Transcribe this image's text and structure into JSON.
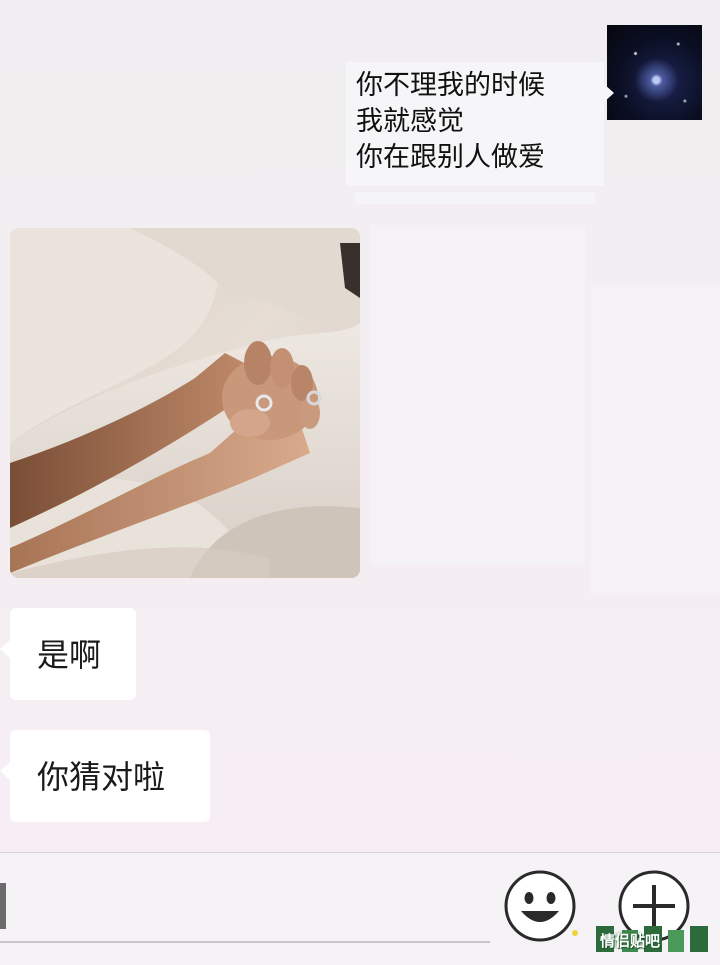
{
  "conversation": {
    "outgoing_message": {
      "lines": [
        "你不理我的时候",
        "我就感觉",
        "你在跟别人做爱"
      ],
      "avatar_icon": "starry-galaxy-avatar"
    },
    "photo_message": {
      "icon": "photo-holding-hands"
    },
    "incoming_messages": [
      {
        "text": "是啊"
      },
      {
        "text": "你猜对啦"
      }
    ]
  },
  "input_bar": {
    "text_value": "",
    "emoji_icon": "smiley-face-icon",
    "plus_icon": "plus-icon"
  },
  "watermark": {
    "text": "情侣贴吧"
  },
  "colors": {
    "background": "#f1eef1",
    "bubble_in": "#ffffff",
    "bubble_out": "#f6f6f8",
    "input_bar": "#f5f3f5"
  }
}
